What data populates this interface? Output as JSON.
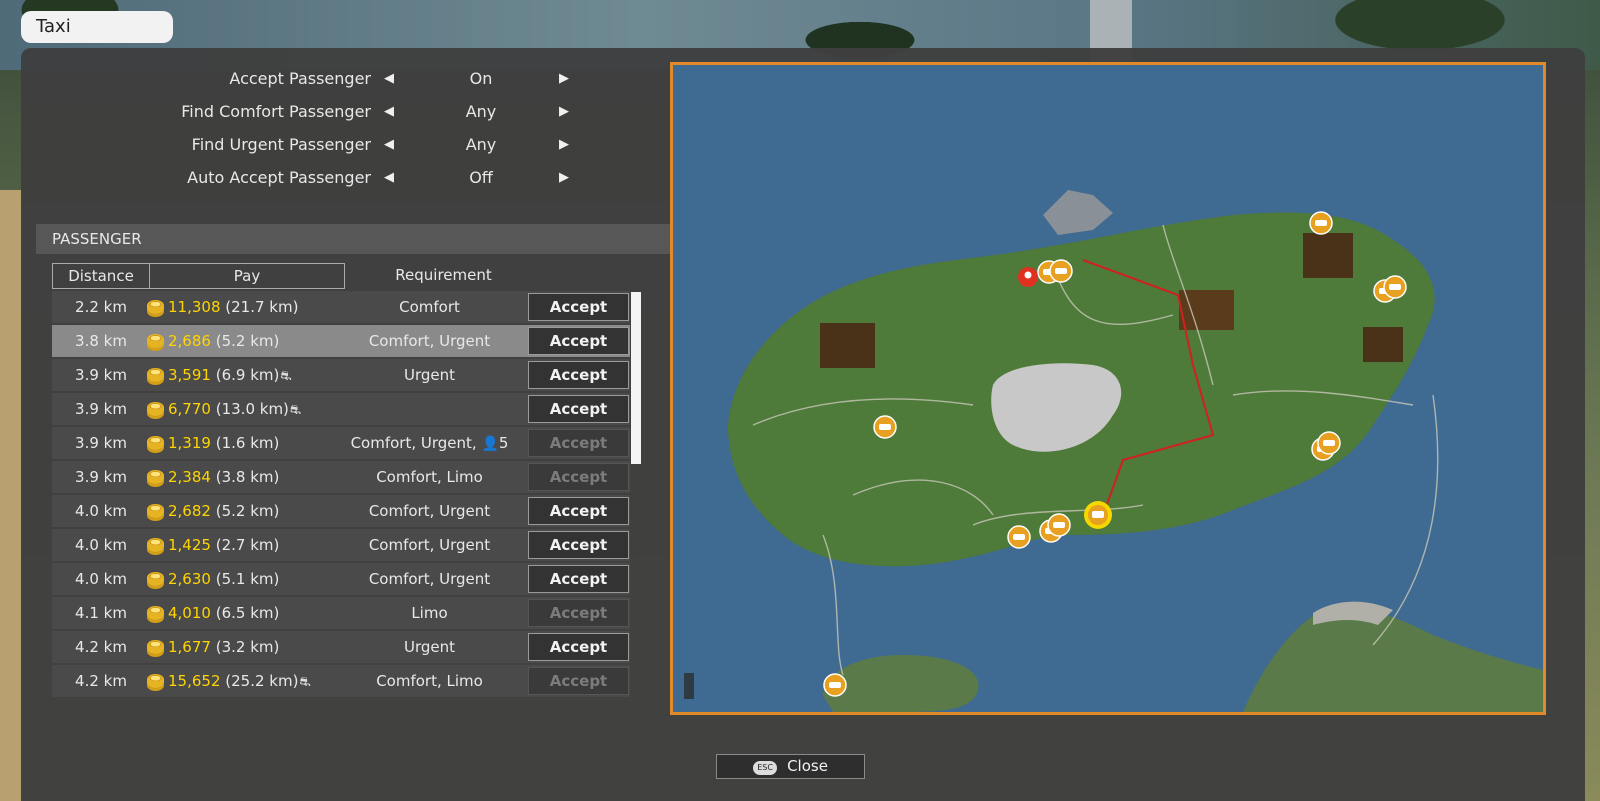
{
  "window": {
    "title": "Taxi"
  },
  "settings": [
    {
      "label": "Accept Passenger",
      "value": "On"
    },
    {
      "label": "Find Comfort Passenger",
      "value": "Any"
    },
    {
      "label": "Find Urgent Passenger",
      "value": "Any"
    },
    {
      "label": "Auto Accept Passenger",
      "value": "Off"
    }
  ],
  "icons": {
    "arrow_left": "◀",
    "arrow_right": "▶",
    "coin": "coin-icon",
    "distance": "road-icon",
    "person": "person-icon",
    "taxi": "taxi-icon",
    "destination": "pin-icon"
  },
  "passenger": {
    "header": "PASSENGER",
    "columns": {
      "distance": "Distance",
      "pay": "Pay",
      "requirement": "Requirement"
    },
    "accept_label": "Accept",
    "rows": [
      {
        "distance": "2.2 km",
        "pay": "11,308",
        "trip": "(21.7 km)",
        "road": false,
        "requirement": "Comfort",
        "capacity": "",
        "enabled": true,
        "selected": false
      },
      {
        "distance": "3.8 km",
        "pay": "2,686",
        "trip": "(5.2 km)",
        "road": false,
        "requirement": "Comfort, Urgent",
        "capacity": "",
        "enabled": true,
        "selected": true
      },
      {
        "distance": "3.9 km",
        "pay": "3,591",
        "trip": "(6.9 km)",
        "road": true,
        "requirement": "Urgent",
        "capacity": "",
        "enabled": true,
        "selected": false
      },
      {
        "distance": "3.9 km",
        "pay": "6,770",
        "trip": "(13.0 km)",
        "road": true,
        "requirement": "",
        "capacity": "",
        "enabled": true,
        "selected": false
      },
      {
        "distance": "3.9 km",
        "pay": "1,319",
        "trip": "(1.6 km)",
        "road": false,
        "requirement": "Comfort, Urgent,",
        "capacity": "5",
        "enabled": false,
        "selected": false
      },
      {
        "distance": "3.9 km",
        "pay": "2,384",
        "trip": "(3.8 km)",
        "road": false,
        "requirement": "Comfort, Limo",
        "capacity": "",
        "enabled": false,
        "selected": false
      },
      {
        "distance": "4.0 km",
        "pay": "2,682",
        "trip": "(5.2 km)",
        "road": false,
        "requirement": "Comfort, Urgent",
        "capacity": "",
        "enabled": true,
        "selected": false
      },
      {
        "distance": "4.0 km",
        "pay": "1,425",
        "trip": "(2.7 km)",
        "road": false,
        "requirement": "Comfort, Urgent",
        "capacity": "",
        "enabled": true,
        "selected": false
      },
      {
        "distance": "4.0 km",
        "pay": "2,630",
        "trip": "(5.1 km)",
        "road": false,
        "requirement": "Comfort, Urgent",
        "capacity": "",
        "enabled": true,
        "selected": false
      },
      {
        "distance": "4.1 km",
        "pay": "4,010",
        "trip": "(6.5 km)",
        "road": false,
        "requirement": "Limo",
        "capacity": "",
        "enabled": false,
        "selected": false
      },
      {
        "distance": "4.2 km",
        "pay": "1,677",
        "trip": "(3.2 km)",
        "road": false,
        "requirement": "Urgent",
        "capacity": "",
        "enabled": true,
        "selected": false
      },
      {
        "distance": "4.2 km",
        "pay": "15,652",
        "trip": "(25.2 km)",
        "road": true,
        "requirement": "Comfort, Limo",
        "capacity": "",
        "enabled": false,
        "selected": false
      }
    ]
  },
  "map": {
    "colors": {
      "sea": "#3f6a92",
      "land": "#4e7a3a",
      "frame": "#e28a2a",
      "route": "#d02020",
      "taxi_marker": "#e8a020",
      "player_marker": "#f5d800"
    }
  },
  "footer": {
    "close_label": "Close",
    "close_key": "ESC"
  }
}
